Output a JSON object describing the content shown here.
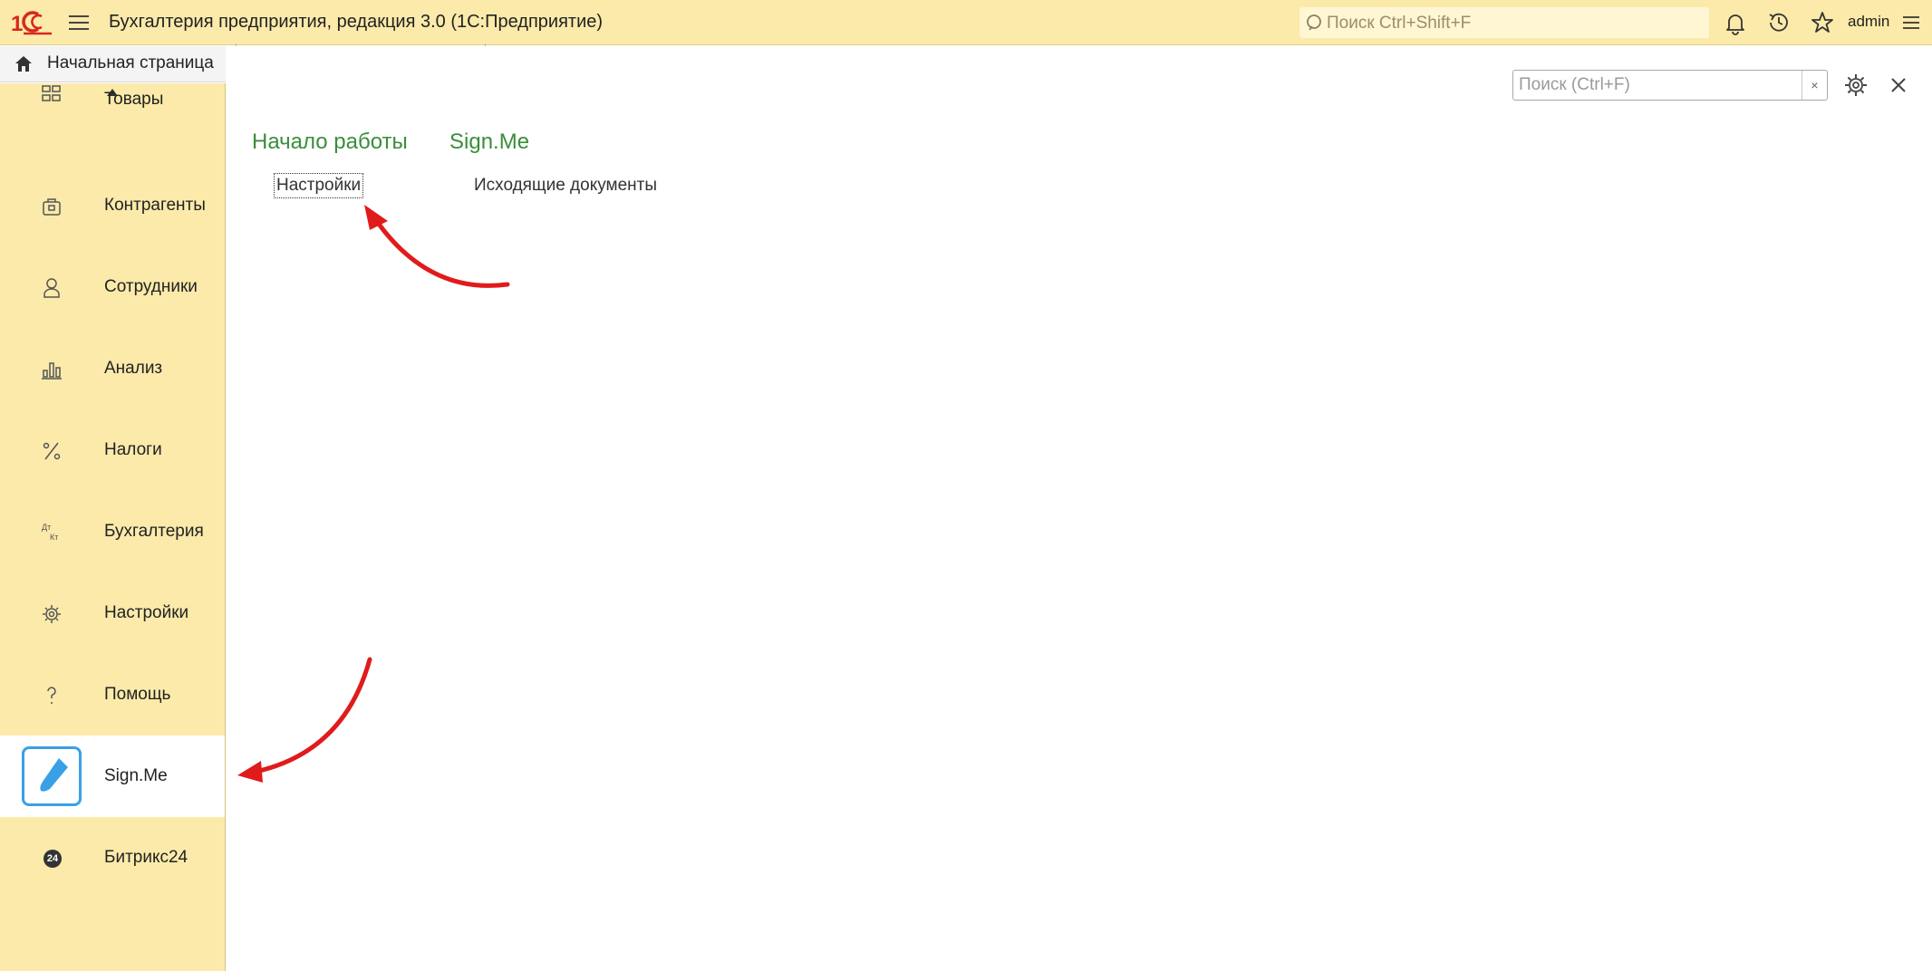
{
  "topbar": {
    "app_title": "Бухгалтерия предприятия, редакция 3.0  (1С:Предприятие)",
    "search_placeholder": "Поиск Ctrl+Shift+F",
    "user_name": "admin",
    "icons": [
      "logo-1c-icon",
      "menu-icon",
      "search-icon",
      "bell-icon",
      "history-icon",
      "star-icon",
      "settings-menu-icon"
    ]
  },
  "home_tab": {
    "label": "Начальная страница"
  },
  "sidebar": {
    "items": [
      {
        "label": "Товары",
        "icon": "goods-icon"
      },
      {
        "label": "Контрагенты",
        "icon": "briefcase-icon"
      },
      {
        "label": "Сотрудники",
        "icon": "person-icon"
      },
      {
        "label": "Анализ",
        "icon": "bar-chart-icon"
      },
      {
        "label": "Налоги",
        "icon": "percent-icon"
      },
      {
        "label": "Бухгалтерия",
        "icon": "debit-credit-icon"
      },
      {
        "label": "Настройки",
        "icon": "gear-icon"
      },
      {
        "label": "Помощь",
        "icon": "question-icon"
      },
      {
        "label": "Sign.Me",
        "icon": "pen-icon",
        "active": true
      },
      {
        "label": "Битрикс24",
        "icon": "bitrix24-icon",
        "badge": "24"
      }
    ]
  },
  "main": {
    "search_placeholder": "Поиск (Ctrl+F)",
    "clear_label": "×",
    "sections": [
      {
        "title": "Начало работы",
        "links": [
          "Настройки"
        ]
      },
      {
        "title": "Sign.Me",
        "links": [
          "Исходящие документы"
        ]
      }
    ]
  },
  "colors": {
    "topbar_bg": "#fbeaaa",
    "section_title": "#3a8e3a",
    "annotation_arrow": "#e01b1b",
    "signme_accent": "#3aa0e6"
  }
}
